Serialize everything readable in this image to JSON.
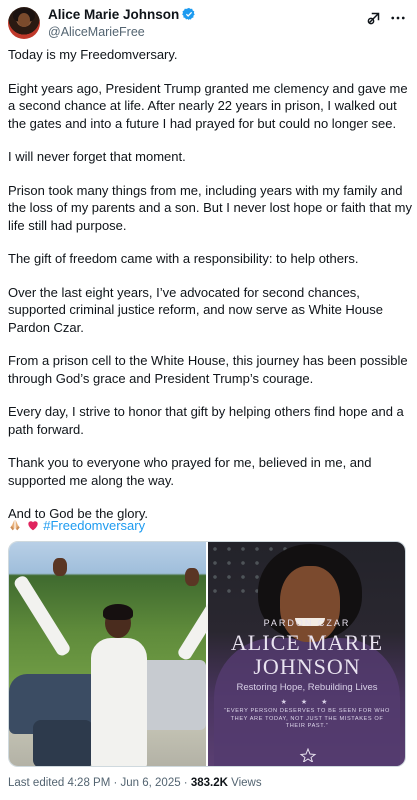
{
  "author": {
    "display_name": "Alice Marie Johnson",
    "handle": "@AliceMarieFree"
  },
  "tweet": {
    "paragraphs": [
      "Today is my Freedomversary.",
      "Eight years ago, President Trump granted me clemency and gave me a second chance at life. After nearly 22 years in prison, I walked out the gates and into a future I had prayed for but could no longer see.",
      "I will never forget that moment.",
      "Prison took many things from me, including years with my family and the loss of my parents and a son. But I never lost hope or faith that my life still had purpose.",
      "The gift of freedom came with a responsibility: to help others.",
      "Over the last eight years, I’ve advocated for second chances, supported criminal justice reform, and now serve as White House Pardon Czar.",
      "From a prison cell to the White House, this journey has been possible through God’s grace and President Trump’s courage.",
      "Every day, I strive to honor that gift by helping others find hope and a path forward.",
      "Thank you to everyone who prayed for me, believed in me, and supported me along the way.",
      "And to God be the glory."
    ],
    "hashtag": "#Freedomversary"
  },
  "media": {
    "right_image": {
      "subtitle": "PARDON CZAR",
      "name_line1": "ALICE MARIE",
      "name_line2": "JOHNSON",
      "tagline": "Restoring Hope, Rebuilding Lives",
      "stars": "★ ★ ★",
      "quote": "“EVERY PERSON DESERVES TO BE SEEN FOR WHO THEY ARE TODAY, NOT JUST THE MISTAKES OF THEIR PAST.”"
    }
  },
  "meta": {
    "edited": "Last edited 4:28 PM · Jun 6, 2025 · ",
    "views_count": "383.2K",
    "views_label": " Views"
  },
  "icons": {
    "verified": "verified-badge-icon",
    "grok": "grok-icon",
    "more": "more-options-icon",
    "emoji": [
      "folded-hands-emoji",
      "red-heart-emoji"
    ]
  },
  "colors": {
    "link": "#1d9bf0",
    "verified": "#1d9bf0",
    "text": "#0f1419",
    "secondary": "#536471"
  }
}
